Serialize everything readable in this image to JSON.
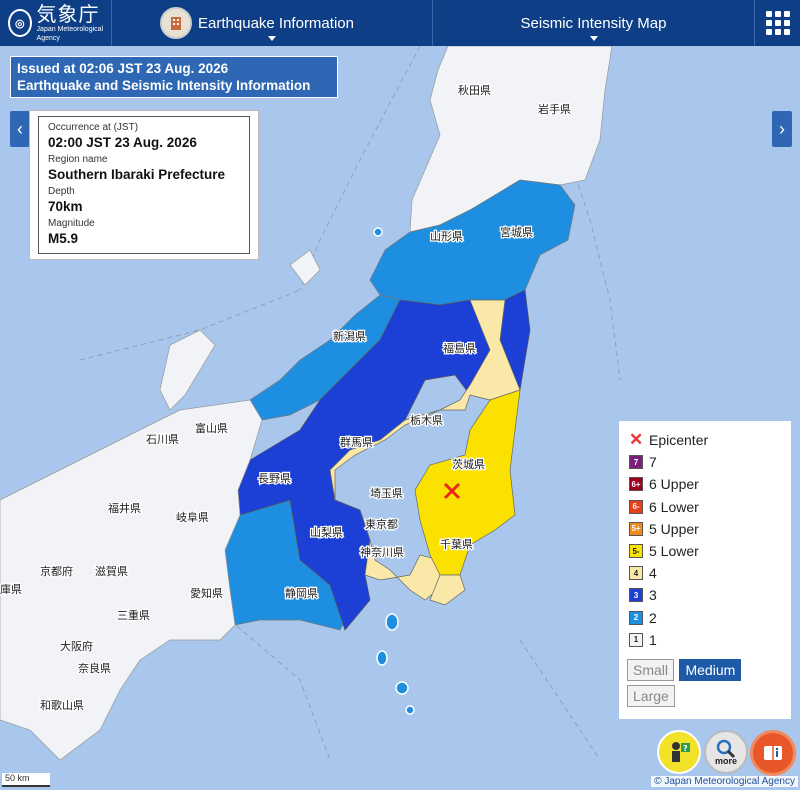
{
  "header": {
    "logo_jp": "気象庁",
    "logo_en": "Japan Meteorological Agency",
    "tab_earthquake": "Earthquake Information",
    "tab_map": "Seismic Intensity Map",
    "menu_icon": "grid-menu-icon"
  },
  "issued": {
    "line1": "Issued at 02:06 JST 23 Aug. 2026",
    "line2": "Earthquake and Seismic Intensity Information"
  },
  "info": {
    "occurrence_label": "Occurrence at (JST)",
    "occurrence_value": "02:00 JST 23 Aug. 2026",
    "region_label": "Region name",
    "region_value": "Southern Ibaraki Prefecture",
    "depth_label": "Depth",
    "depth_value": "70km",
    "magnitude_label": "Magnitude",
    "magnitude_value": "M5.9"
  },
  "legend": {
    "epicenter": "Epicenter",
    "items": [
      {
        "badge": "7",
        "label": "7",
        "color": "#7b1f7a",
        "text_color": "#fff"
      },
      {
        "badge": "6+",
        "label": "6 Upper",
        "color": "#a0001e",
        "text_color": "#fff"
      },
      {
        "badge": "6-",
        "label": "6 Lower",
        "color": "#e8401c",
        "text_color": "#fff"
      },
      {
        "badge": "5+",
        "label": "5 Upper",
        "color": "#f08a1c",
        "text_color": "#fff"
      },
      {
        "badge": "5-",
        "label": "5 Lower",
        "color": "#fbe100",
        "text_color": "#222"
      },
      {
        "badge": "4",
        "label": "4",
        "color": "#f9e8a8",
        "text_color": "#222"
      },
      {
        "badge": "3",
        "label": "3",
        "color": "#1c3fd6",
        "text_color": "#fff"
      },
      {
        "badge": "2",
        "label": "2",
        "color": "#1e8fe0",
        "text_color": "#fff"
      },
      {
        "badge": "1",
        "label": "1",
        "color": "#f1f3f7",
        "text_color": "#222"
      }
    ],
    "size_small": "Small",
    "size_medium": "Medium",
    "size_large": "Large"
  },
  "prefectures": {
    "akita": "秋田県",
    "iwate": "岩手県",
    "yamagata": "山形県",
    "miyagi": "宮城県",
    "niigata": "新潟県",
    "fukushima": "福島県",
    "tochigi": "栃木県",
    "gunma": "群馬県",
    "ibaraki": "茨城県",
    "saitama": "埼玉県",
    "tokyo": "東京都",
    "chiba": "千葉県",
    "kanagawa": "神奈川県",
    "yamanashi": "山梨県",
    "nagano": "長野県",
    "shizuoka": "静岡県",
    "toyama": "富山県",
    "ishikawa": "石川県",
    "fukui": "福井県",
    "gifu": "岐阜県",
    "aichi": "愛知県",
    "kyoto": "京都府",
    "shiga": "滋賀県",
    "mie": "三重県",
    "osaka": "大阪府",
    "nara": "奈良県",
    "wakayama": "和歌山県",
    "hyogo": "庫県"
  },
  "tools": {
    "more_label": "more"
  },
  "scale_label": "50 km",
  "copyright": "© Japan Meteorological Agency"
}
